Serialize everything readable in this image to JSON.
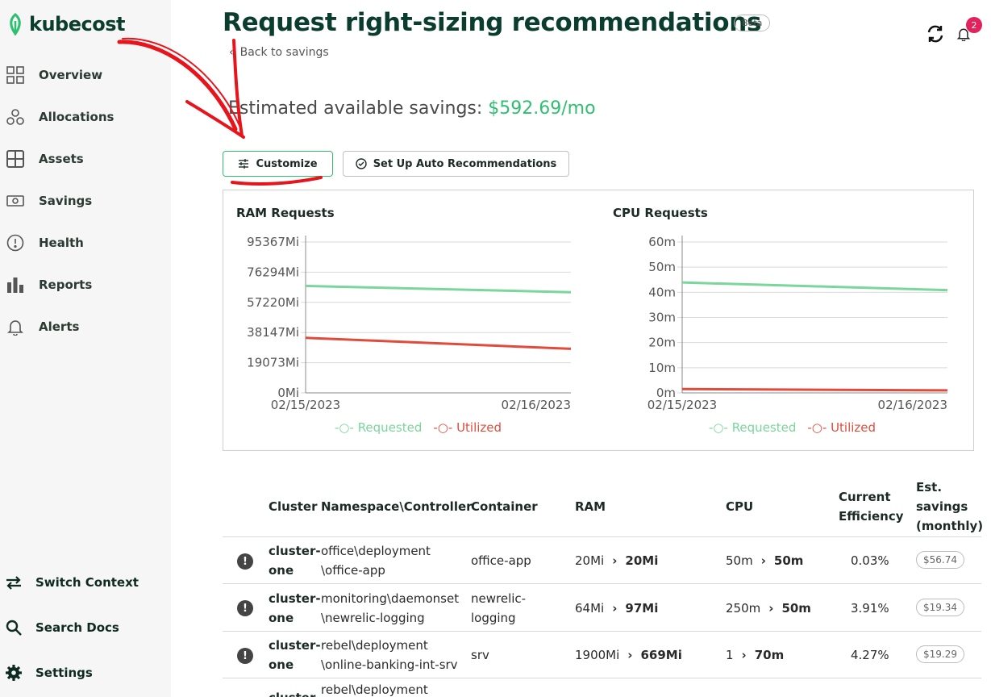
{
  "app": {
    "name": "kubecost"
  },
  "sidebar": {
    "items": [
      {
        "label": "Overview",
        "icon": "grid-icon"
      },
      {
        "label": "Allocations",
        "icon": "circles-icon"
      },
      {
        "label": "Assets",
        "icon": "assets-icon"
      },
      {
        "label": "Savings",
        "icon": "money-icon"
      },
      {
        "label": "Health",
        "icon": "exclamation-circle-icon"
      },
      {
        "label": "Reports",
        "icon": "bar-chart-icon"
      },
      {
        "label": "Alerts",
        "icon": "bell-icon"
      }
    ],
    "bottom_items": [
      {
        "label": "Switch Context",
        "icon": "switch-arrows-icon"
      },
      {
        "label": "Search Docs",
        "icon": "search-icon"
      },
      {
        "label": "Settings",
        "icon": "gear-icon"
      }
    ]
  },
  "header": {
    "title": "Request right-sizing recommendations",
    "badge": "Beta",
    "back_label": "Back to savings",
    "notification_count": "2"
  },
  "savings": {
    "prefix": "Estimated available savings: ",
    "amount": "$592.69/mo"
  },
  "buttons": {
    "customize": "Customize",
    "auto": "Set Up Auto Recommendations"
  },
  "colors": {
    "accent": "#2fbf71",
    "requested": "#7ad69a",
    "utilized": "#e24b3c",
    "brand": "#0b3d2e"
  },
  "chart_data": [
    {
      "type": "line",
      "title": "RAM Requests",
      "x": [
        "02/15/2023",
        "02/16/2023"
      ],
      "y_ticks": [
        "0Mi",
        "19073Mi",
        "38147Mi",
        "57220Mi",
        "76294Mi",
        "95367Mi"
      ],
      "ylim": [
        0,
        100000
      ],
      "series": [
        {
          "name": "Requested",
          "values": [
            68000,
            64000
          ]
        },
        {
          "name": "Utilized",
          "values": [
            35000,
            28000
          ]
        }
      ],
      "legend": "bottom"
    },
    {
      "type": "line",
      "title": "CPU Requests",
      "x": [
        "02/15/2023",
        "02/16/2023"
      ],
      "y_ticks": [
        "0m",
        "10m",
        "20m",
        "30m",
        "40m",
        "50m",
        "60m"
      ],
      "ylim": [
        0,
        62
      ],
      "series": [
        {
          "name": "Requested",
          "values": [
            43.5,
            40.5
          ]
        },
        {
          "name": "Utilized",
          "values": [
            1.5,
            1.0
          ]
        }
      ],
      "legend": "bottom"
    }
  ],
  "table": {
    "headers": {
      "cluster": "Cluster",
      "namespace": "Namespace\\Controller",
      "container": "Container",
      "ram": "RAM",
      "cpu": "CPU",
      "efficiency_1": "Current",
      "efficiency_2": "Efficiency",
      "savings_1": "Est.",
      "savings_2": "savings",
      "savings_3": "(monthly)"
    },
    "rows": [
      {
        "cluster_1": "cluster-",
        "cluster_2": "one",
        "ns_1": "office\\deployment",
        "ns_2": "\\office-app",
        "container_1": "office-app",
        "container_2": "",
        "ram_from": "20Mi",
        "ram_to": "20Mi",
        "cpu_from": "50m",
        "cpu_to": "50m",
        "efficiency": "0.03%",
        "savings": "$56.74"
      },
      {
        "cluster_1": "cluster-",
        "cluster_2": "one",
        "ns_1": "monitoring\\daemonset",
        "ns_2": "\\newrelic-logging",
        "container_1": "newrelic-",
        "container_2": "logging",
        "ram_from": "64Mi",
        "ram_to": "97Mi",
        "cpu_from": "250m",
        "cpu_to": "50m",
        "efficiency": "3.91%",
        "savings": "$19.34"
      },
      {
        "cluster_1": "cluster-",
        "cluster_2": "one",
        "ns_1": "rebel\\deployment",
        "ns_2": "\\online-banking-int-srv",
        "container_1": "srv",
        "container_2": "",
        "ram_from": "1900Mi",
        "ram_to": "669Mi",
        "cpu_from": "1",
        "cpu_to": "70m",
        "efficiency": "4.27%",
        "savings": "$19.29"
      },
      {
        "cluster_1": "cluster-",
        "cluster_2": "",
        "ns_1": "rebel\\deployment",
        "ns_2": "",
        "container_1": "",
        "container_2": "",
        "ram_from": "",
        "ram_to": "",
        "cpu_from": "",
        "cpu_to": "",
        "efficiency": "",
        "savings": ""
      }
    ]
  }
}
